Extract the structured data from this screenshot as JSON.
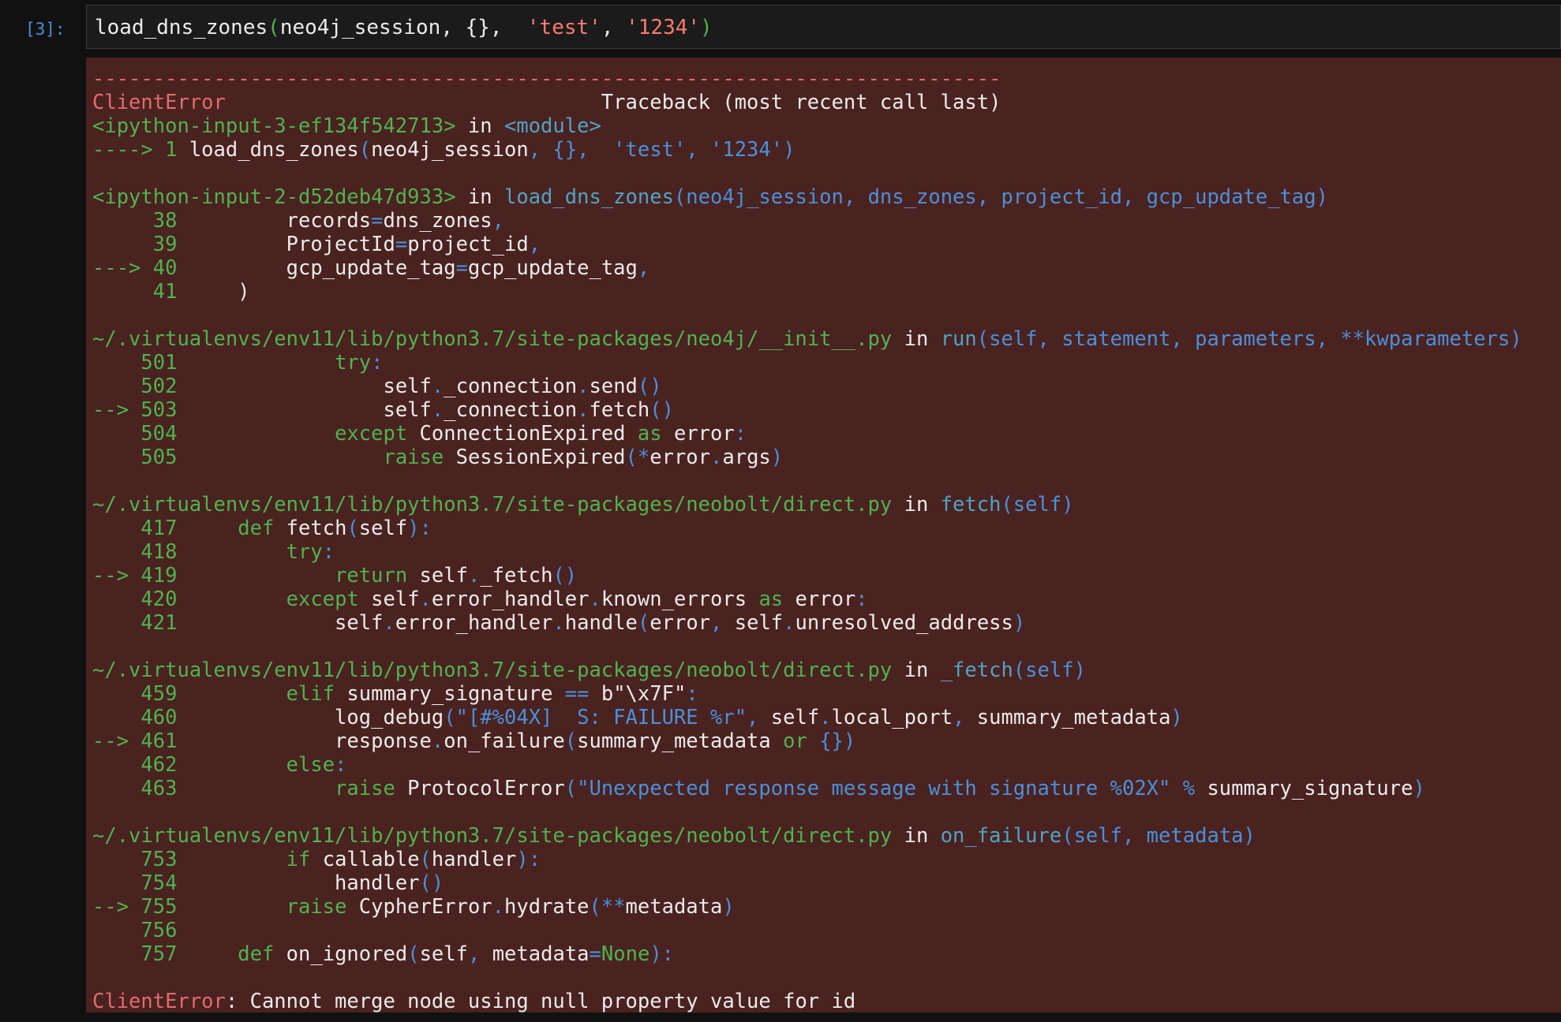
{
  "prompt": "[3]:",
  "input": [
    {
      "t": "load_dns_zones",
      "c": "wht"
    },
    {
      "t": "(",
      "c": "grn"
    },
    {
      "t": "neo4j_session",
      "c": "wht"
    },
    {
      "t": ", {},  ",
      "c": "wht"
    },
    {
      "t": "'test'",
      "c": "str"
    },
    {
      "t": ", ",
      "c": "wht"
    },
    {
      "t": "'1234'",
      "c": "str"
    },
    {
      "t": ")",
      "c": "grn"
    }
  ],
  "traceback": [
    [
      {
        "t": "---------------------------------------------------------------------------",
        "c": "sep"
      }
    ],
    [
      {
        "t": "ClientError",
        "c": "err"
      },
      {
        "t": "                               Traceback (most recent call last)",
        "c": "wht"
      }
    ],
    [
      {
        "t": "<ipython-input-3-ef134f542713>",
        "c": "grn"
      },
      {
        "t": " in ",
        "c": "wht"
      },
      {
        "t": "<module>",
        "c": "cyn"
      }
    ],
    [
      {
        "t": "----> 1 ",
        "c": "grn"
      },
      {
        "t": "load_dns_zones",
        "c": "wht"
      },
      {
        "t": "(",
        "c": "blu"
      },
      {
        "t": "neo4j_session",
        "c": "wht"
      },
      {
        "t": ", {},  'test', '1234')",
        "c": "blu"
      }
    ],
    [],
    [
      {
        "t": "<ipython-input-2-d52deb47d933>",
        "c": "grn"
      },
      {
        "t": " in ",
        "c": "wht"
      },
      {
        "t": "load_dns_zones",
        "c": "cyn"
      },
      {
        "t": "(neo4j_session, dns_zones, project_id, gcp_update_tag)",
        "c": "blu"
      }
    ],
    [
      {
        "t": "     38 ",
        "c": "grn"
      },
      {
        "t": "        records",
        "c": "wht"
      },
      {
        "t": "=",
        "c": "blu"
      },
      {
        "t": "dns_zones",
        "c": "wht"
      },
      {
        "t": ",",
        "c": "blu"
      }
    ],
    [
      {
        "t": "     39 ",
        "c": "grn"
      },
      {
        "t": "        ProjectId",
        "c": "wht"
      },
      {
        "t": "=",
        "c": "blu"
      },
      {
        "t": "project_id",
        "c": "wht"
      },
      {
        "t": ",",
        "c": "blu"
      }
    ],
    [
      {
        "t": "---> 40 ",
        "c": "grn"
      },
      {
        "t": "        gcp_update_tag",
        "c": "wht"
      },
      {
        "t": "=",
        "c": "blu"
      },
      {
        "t": "gcp_update_tag",
        "c": "wht"
      },
      {
        "t": ",",
        "c": "blu"
      }
    ],
    [
      {
        "t": "     41 ",
        "c": "grn"
      },
      {
        "t": "    )",
        "c": "wht"
      }
    ],
    [],
    [
      {
        "t": "~/.virtualenvs/env11/lib/python3.7/site-packages/neo4j/__init__.py",
        "c": "grn"
      },
      {
        "t": " in ",
        "c": "wht"
      },
      {
        "t": "run",
        "c": "cyn"
      },
      {
        "t": "(self, statement, parameters, **kwparameters)",
        "c": "blu"
      }
    ],
    [
      {
        "t": "    501 ",
        "c": "grn"
      },
      {
        "t": "            ",
        "c": "wht"
      },
      {
        "t": "try",
        "c": "grn"
      },
      {
        "t": ":",
        "c": "blu"
      }
    ],
    [
      {
        "t": "    502 ",
        "c": "grn"
      },
      {
        "t": "                self",
        "c": "wht"
      },
      {
        "t": ".",
        "c": "blu"
      },
      {
        "t": "_connection",
        "c": "wht"
      },
      {
        "t": ".",
        "c": "blu"
      },
      {
        "t": "send",
        "c": "wht"
      },
      {
        "t": "()",
        "c": "blu"
      }
    ],
    [
      {
        "t": "--> 503 ",
        "c": "grn"
      },
      {
        "t": "                self",
        "c": "wht"
      },
      {
        "t": ".",
        "c": "blu"
      },
      {
        "t": "_connection",
        "c": "wht"
      },
      {
        "t": ".",
        "c": "blu"
      },
      {
        "t": "fetch",
        "c": "wht"
      },
      {
        "t": "()",
        "c": "blu"
      }
    ],
    [
      {
        "t": "    504 ",
        "c": "grn"
      },
      {
        "t": "            ",
        "c": "wht"
      },
      {
        "t": "except",
        "c": "grn"
      },
      {
        "t": " ConnectionExpired ",
        "c": "wht"
      },
      {
        "t": "as",
        "c": "grn"
      },
      {
        "t": " error",
        "c": "wht"
      },
      {
        "t": ":",
        "c": "blu"
      }
    ],
    [
      {
        "t": "    505 ",
        "c": "grn"
      },
      {
        "t": "                ",
        "c": "wht"
      },
      {
        "t": "raise",
        "c": "grn"
      },
      {
        "t": " SessionExpired",
        "c": "wht"
      },
      {
        "t": "(*",
        "c": "blu"
      },
      {
        "t": "error",
        "c": "wht"
      },
      {
        "t": ".",
        "c": "blu"
      },
      {
        "t": "args",
        "c": "wht"
      },
      {
        "t": ")",
        "c": "blu"
      }
    ],
    [],
    [
      {
        "t": "~/.virtualenvs/env11/lib/python3.7/site-packages/neobolt/direct.py",
        "c": "grn"
      },
      {
        "t": " in ",
        "c": "wht"
      },
      {
        "t": "fetch",
        "c": "cyn"
      },
      {
        "t": "(self)",
        "c": "blu"
      }
    ],
    [
      {
        "t": "    417 ",
        "c": "grn"
      },
      {
        "t": "    ",
        "c": "wht"
      },
      {
        "t": "def",
        "c": "grn"
      },
      {
        "t": " fetch",
        "c": "wht"
      },
      {
        "t": "(",
        "c": "blu"
      },
      {
        "t": "self",
        "c": "wht"
      },
      {
        "t": "):",
        "c": "blu"
      }
    ],
    [
      {
        "t": "    418 ",
        "c": "grn"
      },
      {
        "t": "        ",
        "c": "wht"
      },
      {
        "t": "try",
        "c": "grn"
      },
      {
        "t": ":",
        "c": "blu"
      }
    ],
    [
      {
        "t": "--> 419 ",
        "c": "grn"
      },
      {
        "t": "            ",
        "c": "wht"
      },
      {
        "t": "return",
        "c": "grn"
      },
      {
        "t": " self",
        "c": "wht"
      },
      {
        "t": ".",
        "c": "blu"
      },
      {
        "t": "_fetch",
        "c": "wht"
      },
      {
        "t": "()",
        "c": "blu"
      }
    ],
    [
      {
        "t": "    420 ",
        "c": "grn"
      },
      {
        "t": "        ",
        "c": "wht"
      },
      {
        "t": "except",
        "c": "grn"
      },
      {
        "t": " self",
        "c": "wht"
      },
      {
        "t": ".",
        "c": "blu"
      },
      {
        "t": "error_handler",
        "c": "wht"
      },
      {
        "t": ".",
        "c": "blu"
      },
      {
        "t": "known_errors ",
        "c": "wht"
      },
      {
        "t": "as",
        "c": "grn"
      },
      {
        "t": " error",
        "c": "wht"
      },
      {
        "t": ":",
        "c": "blu"
      }
    ],
    [
      {
        "t": "    421 ",
        "c": "grn"
      },
      {
        "t": "            self",
        "c": "wht"
      },
      {
        "t": ".",
        "c": "blu"
      },
      {
        "t": "error_handler",
        "c": "wht"
      },
      {
        "t": ".",
        "c": "blu"
      },
      {
        "t": "handle",
        "c": "wht"
      },
      {
        "t": "(",
        "c": "blu"
      },
      {
        "t": "error",
        "c": "wht"
      },
      {
        "t": ", ",
        "c": "blu"
      },
      {
        "t": "self",
        "c": "wht"
      },
      {
        "t": ".",
        "c": "blu"
      },
      {
        "t": "unresolved_address",
        "c": "wht"
      },
      {
        "t": ")",
        "c": "blu"
      }
    ],
    [],
    [
      {
        "t": "~/.virtualenvs/env11/lib/python3.7/site-packages/neobolt/direct.py",
        "c": "grn"
      },
      {
        "t": " in ",
        "c": "wht"
      },
      {
        "t": "_fetch",
        "c": "cyn"
      },
      {
        "t": "(self)",
        "c": "blu"
      }
    ],
    [
      {
        "t": "    459 ",
        "c": "grn"
      },
      {
        "t": "        ",
        "c": "wht"
      },
      {
        "t": "elif",
        "c": "grn"
      },
      {
        "t": " summary_signature ",
        "c": "wht"
      },
      {
        "t": "==",
        "c": "blu"
      },
      {
        "t": " b\"\\x7F\"",
        "c": "wht"
      },
      {
        "t": ":",
        "c": "blu"
      }
    ],
    [
      {
        "t": "    460 ",
        "c": "grn"
      },
      {
        "t": "            log_debug",
        "c": "wht"
      },
      {
        "t": "(\"[#%04X]  S: FAILURE %r\",",
        "c": "blu"
      },
      {
        "t": " self",
        "c": "wht"
      },
      {
        "t": ".",
        "c": "blu"
      },
      {
        "t": "local_port",
        "c": "wht"
      },
      {
        "t": ", ",
        "c": "blu"
      },
      {
        "t": "summary_metadata",
        "c": "wht"
      },
      {
        "t": ")",
        "c": "blu"
      }
    ],
    [
      {
        "t": "--> 461 ",
        "c": "grn"
      },
      {
        "t": "            response",
        "c": "wht"
      },
      {
        "t": ".",
        "c": "blu"
      },
      {
        "t": "on_failure",
        "c": "wht"
      },
      {
        "t": "(",
        "c": "blu"
      },
      {
        "t": "summary_metadata ",
        "c": "wht"
      },
      {
        "t": "or",
        "c": "grn"
      },
      {
        "t": " {})",
        "c": "blu"
      }
    ],
    [
      {
        "t": "    462 ",
        "c": "grn"
      },
      {
        "t": "        ",
        "c": "wht"
      },
      {
        "t": "else",
        "c": "grn"
      },
      {
        "t": ":",
        "c": "blu"
      }
    ],
    [
      {
        "t": "    463 ",
        "c": "grn"
      },
      {
        "t": "            ",
        "c": "wht"
      },
      {
        "t": "raise",
        "c": "grn"
      },
      {
        "t": " ProtocolError",
        "c": "wht"
      },
      {
        "t": "(\"Unexpected response message with signature %02X\" %",
        "c": "blu"
      },
      {
        "t": " summary_signature",
        "c": "wht"
      },
      {
        "t": ")",
        "c": "blu"
      }
    ],
    [],
    [
      {
        "t": "~/.virtualenvs/env11/lib/python3.7/site-packages/neobolt/direct.py",
        "c": "grn"
      },
      {
        "t": " in ",
        "c": "wht"
      },
      {
        "t": "on_failure",
        "c": "cyn"
      },
      {
        "t": "(self, metadata)",
        "c": "blu"
      }
    ],
    [
      {
        "t": "    753 ",
        "c": "grn"
      },
      {
        "t": "        ",
        "c": "wht"
      },
      {
        "t": "if",
        "c": "grn"
      },
      {
        "t": " callable",
        "c": "wht"
      },
      {
        "t": "(",
        "c": "blu"
      },
      {
        "t": "handler",
        "c": "wht"
      },
      {
        "t": "):",
        "c": "blu"
      }
    ],
    [
      {
        "t": "    754 ",
        "c": "grn"
      },
      {
        "t": "            handler",
        "c": "wht"
      },
      {
        "t": "()",
        "c": "blu"
      }
    ],
    [
      {
        "t": "--> 755 ",
        "c": "grn"
      },
      {
        "t": "        ",
        "c": "wht"
      },
      {
        "t": "raise",
        "c": "grn"
      },
      {
        "t": " CypherError",
        "c": "wht"
      },
      {
        "t": ".",
        "c": "blu"
      },
      {
        "t": "hydrate",
        "c": "wht"
      },
      {
        "t": "(**",
        "c": "blu"
      },
      {
        "t": "metadata",
        "c": "wht"
      },
      {
        "t": ")",
        "c": "blu"
      }
    ],
    [
      {
        "t": "    756 ",
        "c": "grn"
      }
    ],
    [
      {
        "t": "    757 ",
        "c": "grn"
      },
      {
        "t": "    ",
        "c": "wht"
      },
      {
        "t": "def",
        "c": "grn"
      },
      {
        "t": " on_ignored",
        "c": "wht"
      },
      {
        "t": "(",
        "c": "blu"
      },
      {
        "t": "self",
        "c": "wht"
      },
      {
        "t": ", ",
        "c": "blu"
      },
      {
        "t": "metadata",
        "c": "wht"
      },
      {
        "t": "=",
        "c": "blu"
      },
      {
        "t": "None",
        "c": "grn"
      },
      {
        "t": "):",
        "c": "blu"
      }
    ],
    [],
    [
      {
        "t": "ClientError",
        "c": "err"
      },
      {
        "t": ": Cannot merge node using null property value for id",
        "c": "wht"
      }
    ]
  ]
}
